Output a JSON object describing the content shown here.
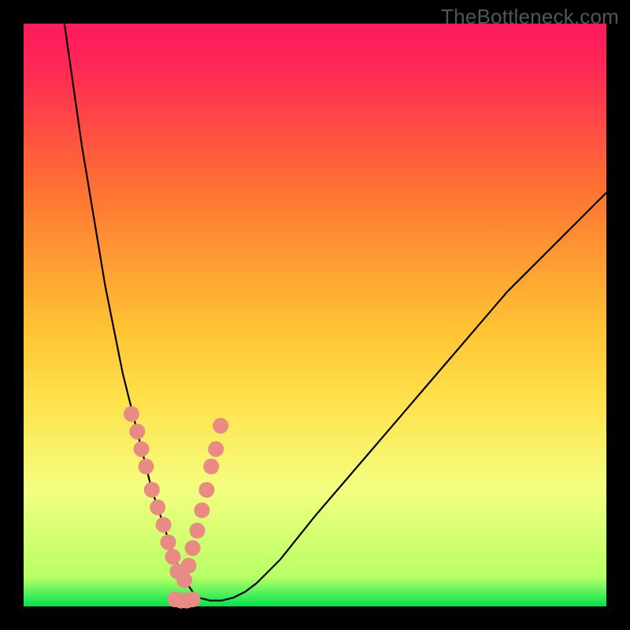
{
  "watermark": "TheBottleneck.com",
  "colors": {
    "frame": "#000000",
    "curve_stroke": "#000000",
    "dot_fill": "#e98a85",
    "dot_stroke": "#c96a65",
    "gradient_stops": [
      "#ff1a5c",
      "#ff2a55",
      "#ff4d44",
      "#ff7033",
      "#ff9a33",
      "#ffc233",
      "#ffe24d",
      "#f3ff80",
      "#b8ff66",
      "#5cf25c",
      "#00e64d"
    ]
  },
  "chart_data": {
    "type": "line",
    "title": "",
    "xlabel": "",
    "ylabel": "",
    "xlim": [
      0,
      100
    ],
    "ylim": [
      0,
      100
    ],
    "x": [
      7,
      8,
      9,
      10,
      11,
      12,
      13,
      14,
      15,
      16,
      17,
      18,
      19,
      20,
      21,
      22,
      23,
      24,
      25,
      26,
      27,
      28,
      29,
      30,
      32,
      34,
      36,
      38,
      40,
      42,
      44,
      46,
      48,
      50,
      53,
      56,
      59,
      62,
      65,
      68,
      71,
      74,
      77,
      80,
      83,
      86,
      89,
      92,
      95,
      98,
      100
    ],
    "values": [
      100,
      93,
      86,
      79,
      73,
      67,
      61,
      55,
      50,
      45,
      40,
      36,
      32,
      28,
      24,
      20,
      17,
      14,
      11,
      8,
      6,
      4,
      2.5,
      1.5,
      1,
      1,
      1.5,
      2.5,
      4,
      6,
      8,
      10.5,
      13,
      15.5,
      19,
      22.5,
      26,
      29.5,
      33,
      36.5,
      40,
      43.5,
      47,
      50.5,
      54,
      57,
      60,
      63,
      66,
      69,
      71
    ],
    "dots_left_branch": [
      {
        "x": 18.5,
        "y": 33
      },
      {
        "x": 19.5,
        "y": 30
      },
      {
        "x": 20.2,
        "y": 27
      },
      {
        "x": 21.0,
        "y": 24
      },
      {
        "x": 22.0,
        "y": 20
      },
      {
        "x": 23.0,
        "y": 17
      },
      {
        "x": 24.0,
        "y": 14
      },
      {
        "x": 24.8,
        "y": 11
      },
      {
        "x": 25.6,
        "y": 8.5
      },
      {
        "x": 26.4,
        "y": 6
      }
    ],
    "dots_right_branch": [
      {
        "x": 33.8,
        "y": 31
      },
      {
        "x": 33.0,
        "y": 27
      },
      {
        "x": 32.2,
        "y": 24
      },
      {
        "x": 31.4,
        "y": 20
      },
      {
        "x": 30.6,
        "y": 16.5
      },
      {
        "x": 29.8,
        "y": 13
      },
      {
        "x": 29.0,
        "y": 10
      },
      {
        "x": 28.3,
        "y": 7
      },
      {
        "x": 27.6,
        "y": 4.5
      }
    ],
    "dots_valley": [
      {
        "x": 26.0,
        "y": 1.2
      },
      {
        "x": 27.0,
        "y": 1.0
      },
      {
        "x": 28.0,
        "y": 1.0
      },
      {
        "x": 29.0,
        "y": 1.2
      }
    ]
  }
}
